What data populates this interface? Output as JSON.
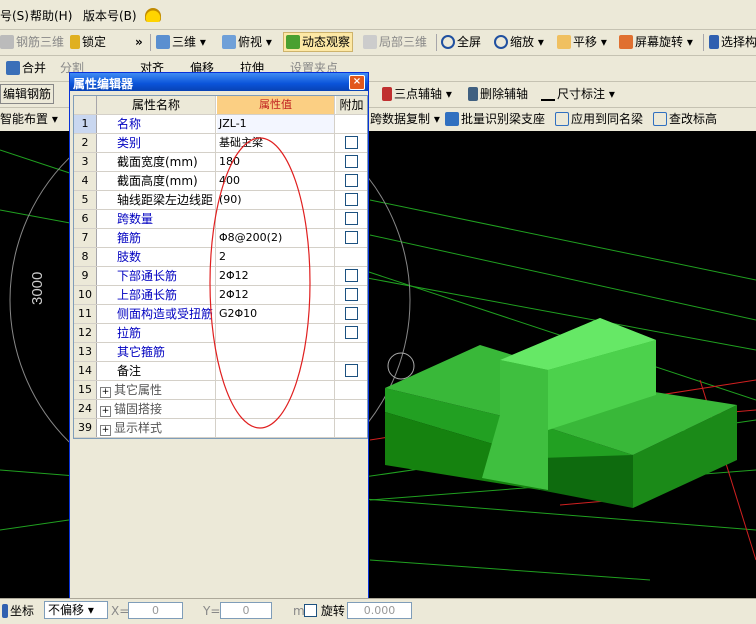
{
  "menubar": {
    "items": [
      "号(S)",
      "帮助(H)",
      "版本号(B)"
    ]
  },
  "toolbar1": {
    "rebar3d": "钢筋三维",
    "lock": "锁定",
    "view3d": "三维",
    "topview": "俯视",
    "dynamic": "动态观察",
    "local3d": "局部三维",
    "fullscreen": "全屏",
    "zoom": "缩放",
    "pan": "平移",
    "rotate": "屏幕旋转",
    "select": "选择构"
  },
  "toolbar2": {
    "merge": "合并",
    "split": "分割",
    "align": "对齐",
    "offset": "偏移",
    "stretch": "拉伸",
    "setpoint": "设置夹点"
  },
  "toolbar3": {
    "edit_rebar": "编辑钢筋",
    "three_point_axis": "三点辅轴",
    "delete_axis": "删除辅轴",
    "dimension": "尺寸标注"
  },
  "toolbar4": {
    "smart_layout": "智能布置",
    "data_copy": "跨数据复制",
    "batch_identify": "批量识别梁支座",
    "apply_same": "应用到同名梁",
    "check_label": "查改标高"
  },
  "dialog": {
    "title": "属性编辑器",
    "close": "×",
    "headers": {
      "name": "属性名称",
      "value": "属性值",
      "extra": "附加"
    },
    "rows": [
      {
        "no": "1",
        "name": "名称",
        "value": "JZL-1",
        "blue": true,
        "check": false
      },
      {
        "no": "2",
        "name": "类别",
        "value": "基础主梁",
        "blue": true,
        "check": true
      },
      {
        "no": "3",
        "name": "截面宽度(mm)",
        "value": "180",
        "blue": false,
        "check": true
      },
      {
        "no": "4",
        "name": "截面高度(mm)",
        "value": "400",
        "blue": false,
        "check": true
      },
      {
        "no": "5",
        "name": "轴线距梁左边线距",
        "value": "(90)",
        "blue": false,
        "check": true
      },
      {
        "no": "6",
        "name": "跨数量",
        "value": "",
        "blue": true,
        "check": true
      },
      {
        "no": "7",
        "name": "箍筋",
        "value": "Φ8@200(2)",
        "blue": true,
        "check": true
      },
      {
        "no": "8",
        "name": "肢数",
        "value": "2",
        "blue": true,
        "check": false
      },
      {
        "no": "9",
        "name": "下部通长筋",
        "value": "2Φ12",
        "blue": true,
        "check": true
      },
      {
        "no": "10",
        "name": "上部通长筋",
        "value": "2Φ12",
        "blue": true,
        "check": true
      },
      {
        "no": "11",
        "name": "侧面构造或受扭筋",
        "value": "G2Φ10",
        "blue": true,
        "check": true
      },
      {
        "no": "12",
        "name": "拉筋",
        "value": "",
        "blue": true,
        "check": true
      },
      {
        "no": "13",
        "name": "其它箍筋",
        "value": "",
        "blue": true,
        "check": false
      },
      {
        "no": "14",
        "name": "备注",
        "value": "",
        "blue": false,
        "check": true
      }
    ],
    "groups": [
      {
        "no": "15",
        "name": "其它属性"
      },
      {
        "no": "24",
        "name": "锚固搭接"
      },
      {
        "no": "39",
        "name": "显示样式"
      }
    ]
  },
  "viewport": {
    "dimension_label": "3000"
  },
  "statusbar": {
    "coord": "坐标",
    "offset_mode": "不偏移",
    "x_label": "X=",
    "x_value": "0",
    "y_label": "Y=",
    "y_value": "0",
    "unit": "mm",
    "rotate": "旋转",
    "rotate_value": "0.000"
  }
}
